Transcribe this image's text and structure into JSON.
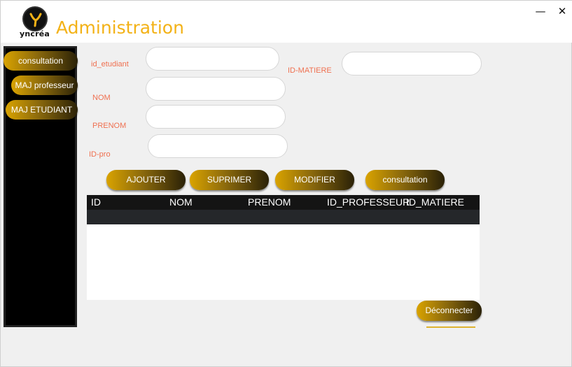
{
  "window": {
    "minimize_glyph": "—",
    "close_glyph": "✕"
  },
  "header": {
    "logo_word": "yncréa",
    "title": "Administration"
  },
  "sidebar": {
    "items": [
      {
        "label": "consultation"
      },
      {
        "label": "MAJ professeur"
      },
      {
        "label": "MAJ ETUDIANT"
      }
    ]
  },
  "form": {
    "id_etudiant_label": "id_etudiant",
    "id_etudiant_value": "",
    "nom_label": "NOM",
    "nom_value": "",
    "prenom_label": "PRENOM",
    "prenom_value": "",
    "id_pro_label": "ID-pro",
    "id_pro_value": "",
    "id_matiere_label": "ID-MATIERE",
    "id_matiere_value": ""
  },
  "actions": {
    "ajouter": "AJOUTER",
    "suprimer": "SUPRIMER",
    "modifier": "MODIFIER",
    "consultation": "consultation"
  },
  "table": {
    "columns": [
      "ID",
      "NOM",
      "PRENOM",
      "ID_PROFESSEUR",
      "ID_MATIERE"
    ]
  },
  "footer": {
    "logout": "Déconnecter"
  },
  "colors": {
    "accent": "#f3b217",
    "label": "#ef7050",
    "sidebar": "#000000",
    "table_header": "#141414"
  }
}
